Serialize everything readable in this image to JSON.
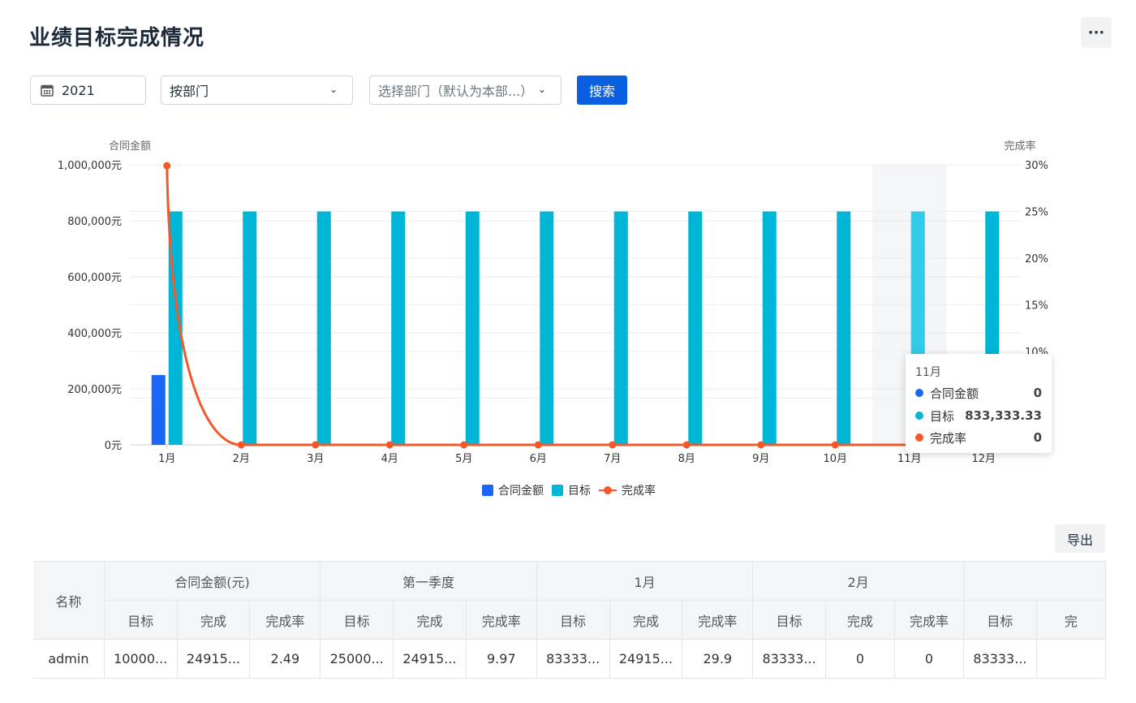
{
  "page": {
    "title": "业绩目标完成情况",
    "more_label": "···"
  },
  "filters": {
    "year": "2021",
    "group_by": "按部门",
    "dept_placeholder": "选择部门（默认为本部...）",
    "search_label": "搜索"
  },
  "colors": {
    "contract": "#1a66f5",
    "target": "#00b6d6",
    "target_hover": "#30cbe8",
    "rate": "#f4582a",
    "primary": "#0a5fe0"
  },
  "chart_data": {
    "type": "bar",
    "categories": [
      "1月",
      "2月",
      "3月",
      "4月",
      "5月",
      "6月",
      "7月",
      "8月",
      "9月",
      "10月",
      "11月",
      "12月"
    ],
    "series": [
      {
        "name": "合同金额",
        "type": "bar",
        "axis": "left",
        "values": [
          249150,
          0,
          0,
          0,
          0,
          0,
          0,
          0,
          0,
          0,
          0,
          0
        ]
      },
      {
        "name": "目标",
        "type": "bar",
        "axis": "left",
        "values": [
          833333.33,
          833333.33,
          833333.33,
          833333.33,
          833333.33,
          833333.33,
          833333.33,
          833333.33,
          833333.33,
          833333.33,
          833333.33,
          833333.33
        ]
      },
      {
        "name": "完成率",
        "type": "line",
        "axis": "right",
        "values": [
          29.9,
          0,
          0,
          0,
          0,
          0,
          0,
          0,
          0,
          0,
          0,
          0
        ]
      }
    ],
    "ylabel_left": "合同金额",
    "ylabel_right": "完成率",
    "ylim_left": [
      0,
      1000000
    ],
    "ylim_right": [
      0,
      30
    ],
    "yticks_left": [
      "0元",
      "200,000元",
      "400,000元",
      "600,000元",
      "800,000元",
      "1,000,000元"
    ],
    "yticks_right": [
      "0%",
      "5%",
      "10%",
      "15%",
      "20%",
      "25%",
      "30%"
    ],
    "highlight_category": "11月",
    "grid": true,
    "legend_position": "bottom"
  },
  "tooltip": {
    "title": "11月",
    "rows": [
      {
        "label": "合同金额",
        "value": "0"
      },
      {
        "label": "目标",
        "value": "833,333.33"
      },
      {
        "label": "完成率",
        "value": "0"
      }
    ]
  },
  "legend": {
    "contract": "合同金额",
    "target": "目标",
    "rate": "完成率"
  },
  "export_label": "导出",
  "table": {
    "name_header": "名称",
    "groups": [
      "合同金额(元)",
      "第一季度",
      "1月",
      "2月",
      ""
    ],
    "sub_headers": [
      "目标",
      "完成",
      "完成率",
      "目标",
      "完成",
      "完成率",
      "目标",
      "完成",
      "完成率",
      "目标",
      "完成",
      "完成率",
      "目标",
      "完"
    ],
    "rows": [
      {
        "name": "admin",
        "cells": [
          "10000...",
          "24915...",
          "2.49",
          "25000...",
          "24915...",
          "9.97",
          "83333...",
          "24915...",
          "29.9",
          "83333...",
          "0",
          "0",
          "83333...",
          ""
        ]
      }
    ]
  }
}
